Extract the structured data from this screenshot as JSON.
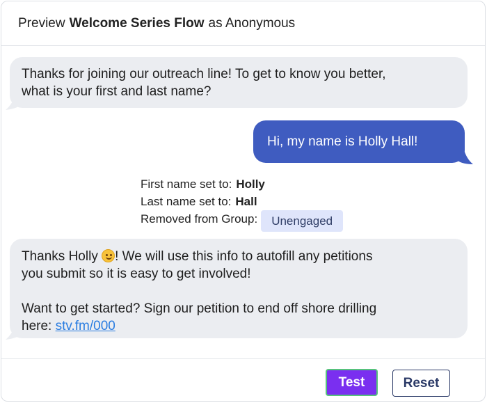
{
  "header": {
    "prefix": "Preview",
    "flow_name": "Welcome Series Flow",
    "suffix": "as Anonymous"
  },
  "messages": [
    {
      "direction": "incoming",
      "lines": [
        "Thanks for joining our outreach line! To get to know you better,",
        "what is your first and last name?"
      ]
    },
    {
      "direction": "outgoing",
      "text": "Hi, my name is Holly Hall!"
    },
    {
      "direction": "incoming",
      "line1_before_emoji": "Thanks Holly ",
      "emoji": "smiling-face-emoji",
      "line1_after_emoji": "! We will use this info to autofill any petitions",
      "line2": "you submit so it is easy to get involved!",
      "line3": "Want to get started? Sign our petition to end off shore drilling",
      "line4_prefix": "here: ",
      "link": "stv.fm/000"
    }
  ],
  "events": {
    "first_name_label": "First name set to:",
    "first_name_value": "Holly",
    "last_name_label": "Last name set to:",
    "last_name_value": "Hall",
    "group_label": "Removed from Group:",
    "group_value": "Unengaged"
  },
  "footer": {
    "test_label": "Test",
    "reset_label": "Reset"
  },
  "colors": {
    "incoming_bubble": "#ebedf1",
    "outgoing_bubble": "#3f5cc0",
    "test_button": "#7a2ff0",
    "link": "#2a7de1"
  }
}
